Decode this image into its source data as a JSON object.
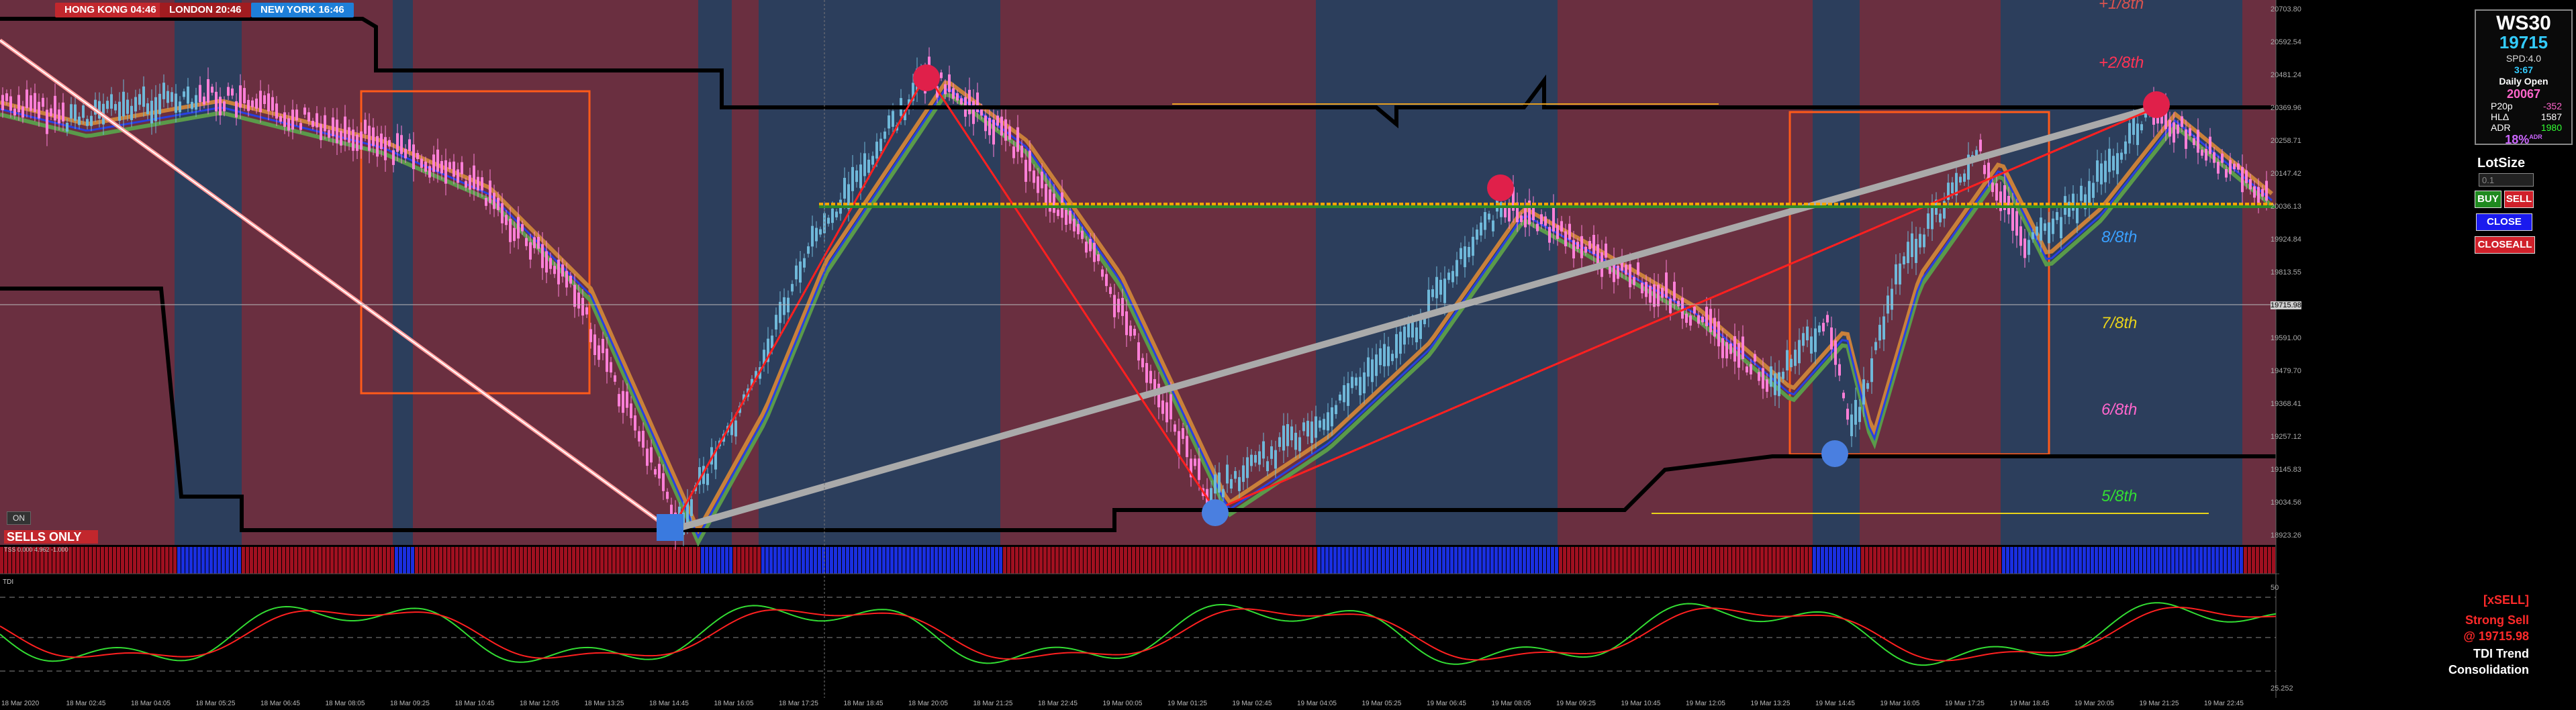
{
  "sessions": [
    {
      "label": "HONG KONG 04:46",
      "color": "#c2272d"
    },
    {
      "label": "LONDON  20:46",
      "color": "#a11c20"
    },
    {
      "label": "NEW YORK 16:46",
      "color": "#1e7fd8"
    }
  ],
  "info": {
    "symbol": "WS30",
    "price": "19715",
    "spread": "SPD:4.0",
    "timer": "3:67",
    "daily_open_label": "Daily Open",
    "daily_open": "20067",
    "rows": [
      {
        "k": "P20p",
        "v": "-352",
        "vc": "#ff66cc"
      },
      {
        "k": "HLΔ",
        "v": "1587",
        "vc": "#ffffff"
      },
      {
        "k": "ADR",
        "v": "1980",
        "vc": "#33ff33"
      }
    ],
    "pct": "18%",
    "pct_suffix": "ADR"
  },
  "trade": {
    "lot_label": "LotSize",
    "lot_value": "0.1",
    "buy": "BUY",
    "sell": "SELL",
    "close": "CLOSE",
    "closeall": "CLOSEALL"
  },
  "murrey": [
    {
      "label": "+1/8th",
      "color": "#d9534f"
    },
    {
      "label": "+2/8th",
      "color": "#ff3355"
    },
    {
      "label": "8/8th",
      "color": "#3aa0ff"
    },
    {
      "label": "7/8th",
      "color": "#e8d21a"
    },
    {
      "label": "6/8th",
      "color": "#ff66cc"
    },
    {
      "label": "5/8th",
      "color": "#33dd33"
    }
  ],
  "status": {
    "on": "ON",
    "sells_only": "SELLS ONLY",
    "ind_label": "TSS 0.000 4.962 -1.000"
  },
  "tdi": {
    "title": "TDI",
    "signal": "[xSELL]",
    "strength": "Strong Sell",
    "at_price": "@ 19715.98",
    "trend_label": "TDI Trend",
    "trend_state": "Consolidation"
  },
  "price_scale": [
    "20703.80",
    "20592.54",
    "20481.24",
    "20369.96",
    "20258.71",
    "20147.42",
    "20036.13",
    "19924.84",
    "19813.55",
    "19715.98",
    "19591.00",
    "19479.70",
    "19368.41",
    "19257.12",
    "19145.83",
    "19034.56",
    "18923.26"
  ],
  "tdi_scale": [
    "50",
    "25.252"
  ],
  "time_labels": [
    "18 Mar 2020",
    "18 Mar 02:45",
    "18 Mar 04:05",
    "18 Mar 05:25",
    "18 Mar 06:45",
    "18 Mar 08:05",
    "18 Mar 09:25",
    "18 Mar 10:45",
    "18 Mar 12:05",
    "18 Mar 13:25",
    "18 Mar 14:45",
    "18 Mar 16:05",
    "18 Mar 17:25",
    "18 Mar 18:45",
    "18 Mar 20:05",
    "18 Mar 21:25",
    "18 Mar 22:45",
    "19 Mar 00:05",
    "19 Mar 01:25",
    "19 Mar 02:45",
    "19 Mar 04:05",
    "19 Mar 05:25",
    "19 Mar 06:45",
    "19 Mar 08:05",
    "19 Mar 09:25",
    "19 Mar 10:45",
    "19 Mar 12:05",
    "19 Mar 13:25",
    "19 Mar 14:45",
    "19 Mar 16:05",
    "19 Mar 17:25",
    "19 Mar 18:45",
    "19 Mar 20:05",
    "19 Mar 21:25",
    "19 Mar 22:45"
  ],
  "colors": {
    "bg": "#000000",
    "bull_zone": "#2c3e5c",
    "bear_zone": "#6a2f40",
    "candle_up": "#6fb8d9",
    "candle_down": "#ff7fd8",
    "buy_signal": "#4a7fe0",
    "sell_signal": "#e0204a"
  }
}
